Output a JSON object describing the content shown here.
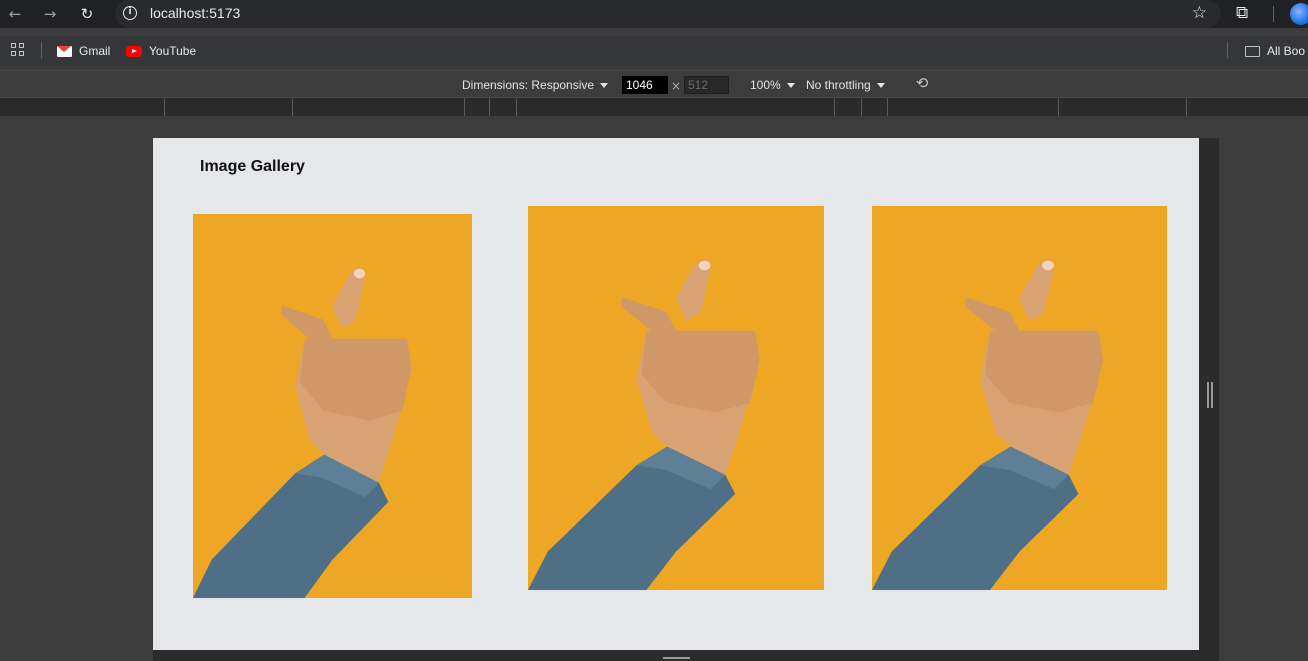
{
  "browser": {
    "url": "localhost:5173",
    "icons": {
      "back": "arrow-left-icon",
      "forward": "arrow-right-icon",
      "reload": "reload-icon",
      "site_info": "info-icon",
      "bookmark_star": "star-icon",
      "extensions": "puzzle-icon",
      "profile": "avatar"
    }
  },
  "bookmarks": {
    "items": [
      {
        "label": "Gmail",
        "icon": "gmail-icon"
      },
      {
        "label": "YouTube",
        "icon": "youtube-icon"
      }
    ],
    "all_bookmarks_label": "All Boo"
  },
  "devtools": {
    "dimensions_label": "Dimensions: Responsive",
    "width_value": "1046",
    "height_value": "512",
    "times": "×",
    "zoom_label": "100%",
    "throttling_label": "No throttling"
  },
  "app": {
    "title": "Image Gallery",
    "images": [
      {
        "alt": "hand making finger heart gesture on yellow background"
      },
      {
        "alt": "hand making finger heart gesture on yellow background"
      },
      {
        "alt": "hand making finger heart gesture on yellow background"
      }
    ]
  },
  "colors": {
    "photo_background": "#eda725",
    "page_background": "#e5e7eb",
    "sleeve": "#4f6f87",
    "skin": "#d8a272"
  }
}
